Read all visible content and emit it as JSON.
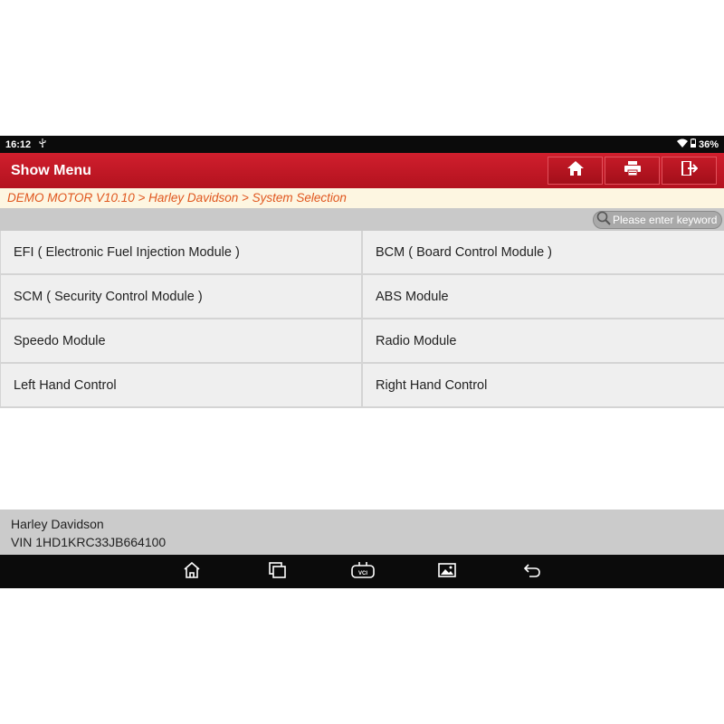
{
  "status_bar": {
    "time": "16:12",
    "battery": "36%"
  },
  "app_bar": {
    "title": "Show Menu"
  },
  "breadcrumb": "DEMO MOTOR V10.10 > Harley Davidson > System Selection",
  "search": {
    "placeholder": "Please enter keyword"
  },
  "modules": [
    "EFI ( Electronic Fuel Injection Module )",
    "BCM ( Board Control Module )",
    "SCM ( Security Control Module )",
    "ABS Module",
    "Speedo Module",
    "Radio Module",
    "Left Hand Control",
    "Right Hand Control"
  ],
  "vehicle": {
    "make": "Harley Davidson",
    "vin": "VIN 1HD1KRC33JB664100"
  },
  "nav_vci_label": "VCI",
  "colors": {
    "app_bar": "#c4192a",
    "breadcrumb_text": "#e0561e",
    "breadcrumb_bg": "#fdf6e1"
  },
  "icons": [
    "home-icon",
    "print-icon",
    "exit-icon",
    "search-icon",
    "wifi-icon",
    "battery-icon",
    "usb-icon",
    "nav-home-icon",
    "nav-recents-icon",
    "nav-vci-icon",
    "nav-gallery-icon",
    "nav-back-icon"
  ]
}
